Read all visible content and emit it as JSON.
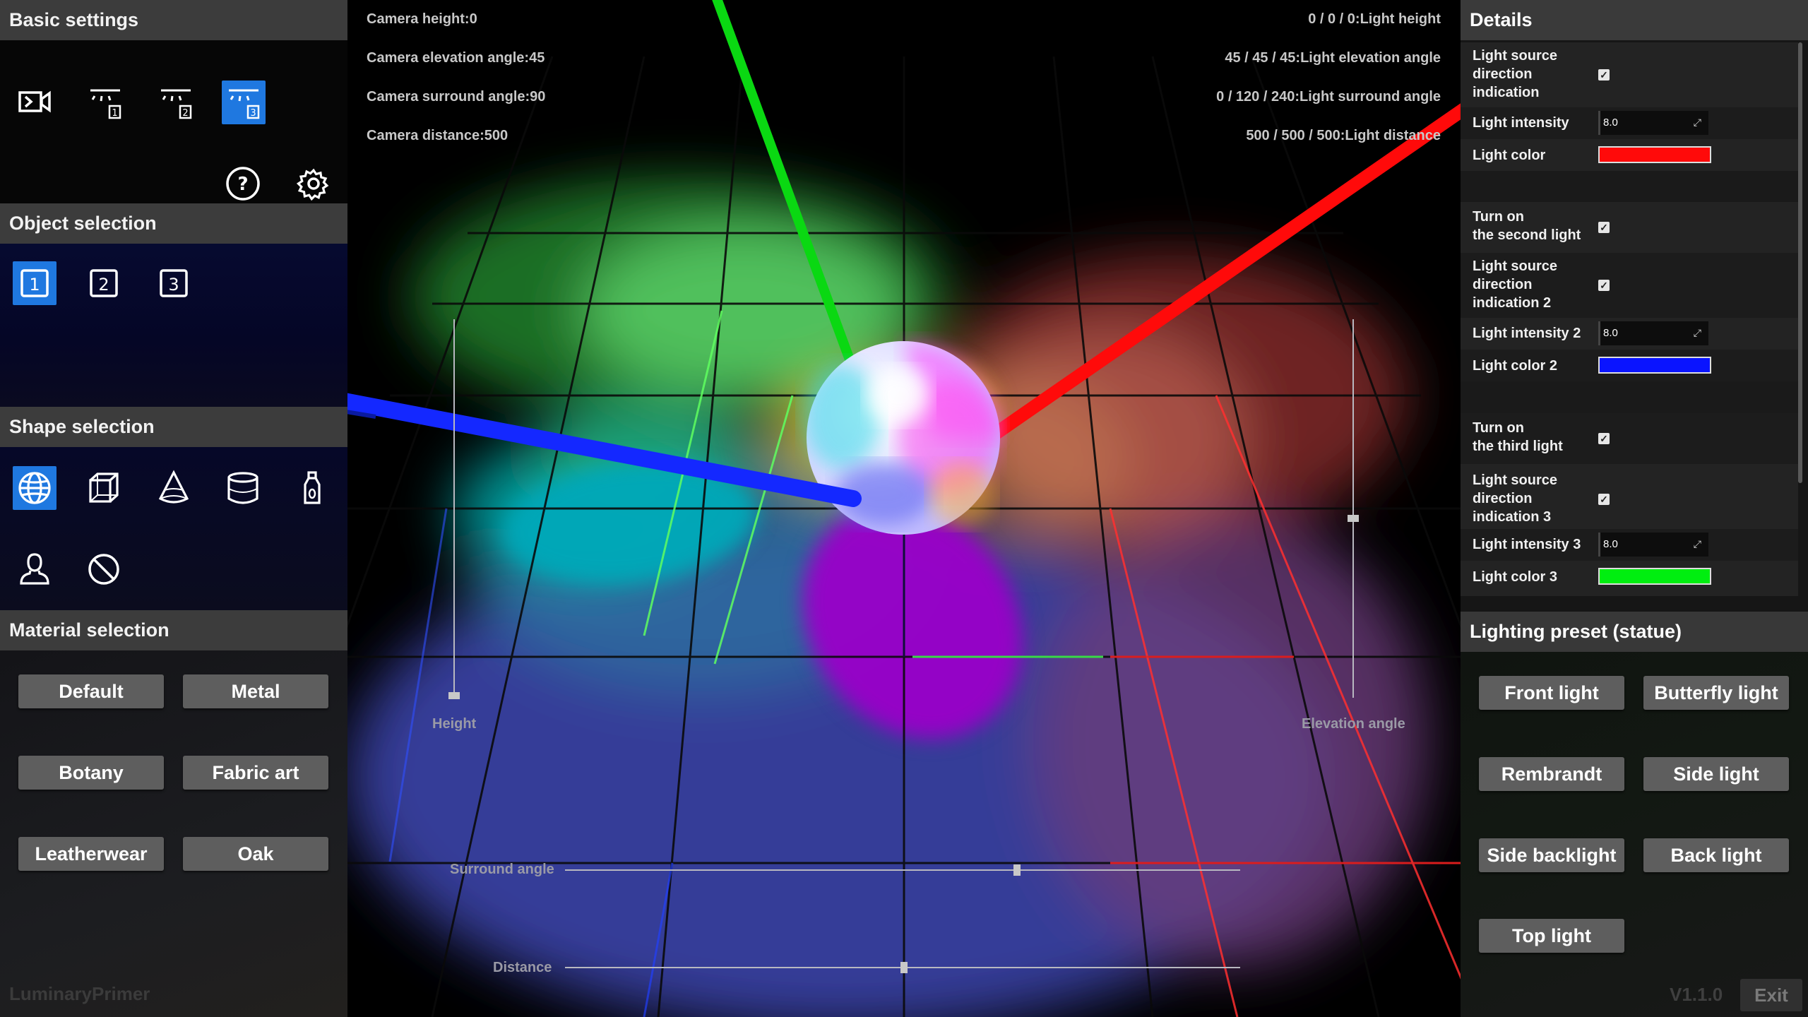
{
  "left_panel": {
    "basic_settings": {
      "title": "Basic settings",
      "icons": [
        "camera-mode-icon",
        "light-1-icon",
        "light-2-icon",
        "light-3-icon",
        "help-icon",
        "gear-icon"
      ],
      "selected": "light-3-icon"
    },
    "object_selection": {
      "title": "Object selection",
      "items": [
        "1",
        "2",
        "3"
      ],
      "selected": "1"
    },
    "shape_selection": {
      "title": "Shape selection",
      "icons": [
        "sphere-icon",
        "cube-icon",
        "cone-icon",
        "cylinder-icon",
        "bottle-icon",
        "bust-icon",
        "none-icon"
      ],
      "selected": "sphere-icon"
    },
    "material_selection": {
      "title": "Material selection",
      "buttons": [
        "Default",
        "Metal",
        "Botany",
        "Fabric art",
        "Leatherwear",
        "Oak"
      ]
    },
    "brand": "LuminaryPrimer"
  },
  "viewport": {
    "camera": {
      "height": "Camera height:0",
      "elevation": "Camera elevation angle:45",
      "surround": "Camera surround angle:90",
      "distance": "Camera distance:500"
    },
    "light": {
      "height": "0 / 0 / 0:Light height",
      "elevation": "45 / 45 / 45:Light elevation angle",
      "surround": "0 / 120 / 240:Light surround angle",
      "distance": "500 / 500 / 500:Light distance"
    },
    "sliders": {
      "height": {
        "label": "Height",
        "value_fraction": 0.05
      },
      "elevation": {
        "label": "Elevation angle",
        "value_fraction": 0.5
      },
      "surround": {
        "label": "Surround angle",
        "value_fraction": 0.67
      },
      "distance": {
        "label": "Distance",
        "value_fraction": 0.5
      }
    },
    "colors": {
      "red": "#ff0000",
      "green": "#00e000",
      "blue": "#0020ff"
    }
  },
  "right_panel": {
    "details": {
      "title": "Details",
      "rows": [
        {
          "label": "Light source\ndirection\nindication",
          "type": "checkbox",
          "checked": true
        },
        {
          "label": "Light intensity",
          "type": "number",
          "value": "8.0"
        },
        {
          "label": "Light color",
          "type": "color",
          "color": "#ff0a0a"
        },
        {
          "label": "Turn on\nthe second light",
          "type": "checkbox",
          "checked": true
        },
        {
          "label": "Light source\ndirection\nindication 2",
          "type": "checkbox",
          "checked": true
        },
        {
          "label": "Light intensity 2",
          "type": "number",
          "value": "8.0"
        },
        {
          "label": "Light color 2",
          "type": "color",
          "color": "#0a14ff"
        },
        {
          "label": "Turn on\nthe third light",
          "type": "checkbox",
          "checked": true
        },
        {
          "label": "Light source\ndirection\nindication 3",
          "type": "checkbox",
          "checked": true
        },
        {
          "label": "Light intensity 3",
          "type": "number",
          "value": "8.0"
        },
        {
          "label": "Light color 3",
          "type": "color",
          "color": "#00ee10"
        }
      ]
    },
    "preset": {
      "title": "Lighting preset (statue)",
      "buttons": [
        "Front light",
        "Butterfly light",
        "Rembrandt",
        "Side light",
        "Side backlight",
        "Back light",
        "Top light"
      ]
    },
    "version": "V1.1.0",
    "exit_label": "Exit"
  }
}
